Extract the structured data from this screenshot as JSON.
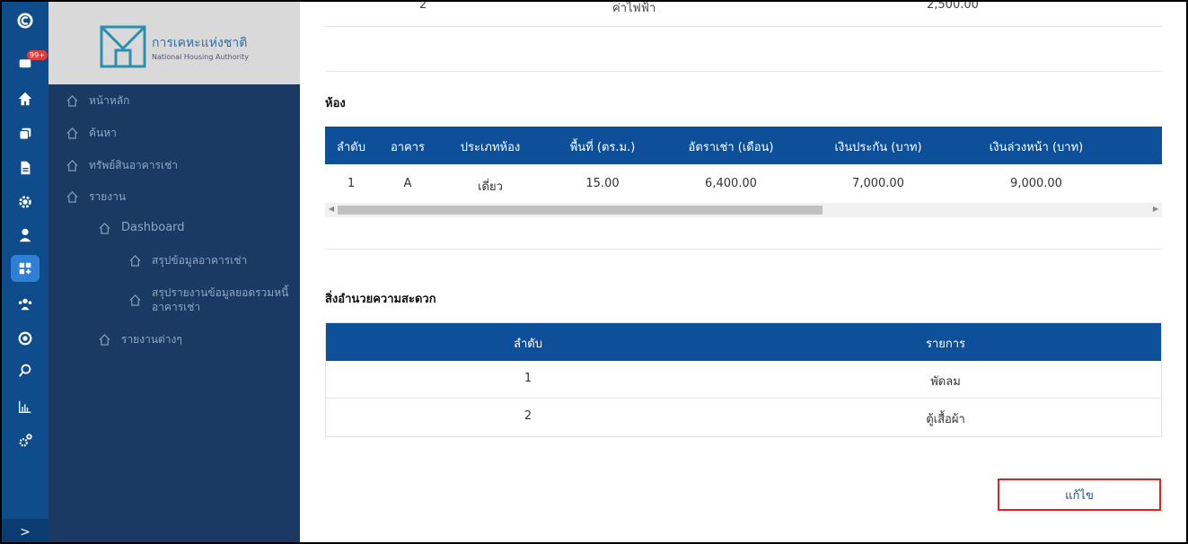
{
  "rail": {
    "badge": "99+",
    "icons": [
      "logo-c-icon",
      "inbox-icon",
      "home-icon",
      "copy-icon",
      "document-icon",
      "gear-icon",
      "user-icon",
      "dashboard-add-icon",
      "group-icon",
      "coin-icon",
      "search-icon",
      "bar-chart-icon",
      "settings-icon"
    ],
    "expand_label": ">"
  },
  "logo": {
    "thai": "การเคหะแห่งชาติ",
    "english": "National Housing Authority"
  },
  "menu": {
    "home": "หน้าหลัก",
    "search": "ค้นหา",
    "assets": "ทรัพย์สินอาคารเช่า",
    "reports": "รายงาน",
    "dashboard": "Dashboard",
    "summary_rental": "สรุปข้อมูลอาคารเช่า",
    "summary_debt": "สรุปรายงานข้อมูลยอดรวมหนี้อาคารเช่า",
    "other_reports": "รายงานต่างๆ"
  },
  "top_row": {
    "index": "2",
    "item": "ค่าไฟฟ้า",
    "amount": "2,500.00"
  },
  "room": {
    "title": "ห้อง",
    "columns": [
      "ลำดับ",
      "อาคาร",
      "ประเภทห้อง",
      "พื้นที่ (ตร.ม.)",
      "อัตราเช่า (เดือน)",
      "เงินประกัน (บาท)",
      "เงินล่วงหน้า (บาท)"
    ],
    "rows": [
      [
        "1",
        "A",
        "เดี่ยว",
        "15.00",
        "6,400.00",
        "7,000.00",
        "9,000.00"
      ]
    ]
  },
  "facilities": {
    "title": "สิ่งอำนวยความสะดวก",
    "columns": [
      "ลำดับ",
      "รายการ"
    ],
    "rows": [
      [
        "1",
        "พัดลม"
      ],
      [
        "2",
        "ตู้เสื้อผ้า"
      ]
    ]
  },
  "edit_button": "แก้ไข",
  "colors": {
    "rail": "#0f4c8c",
    "menu": "#1a3a63",
    "table_header": "#0e4f99",
    "highlight": "#e01f1f"
  }
}
